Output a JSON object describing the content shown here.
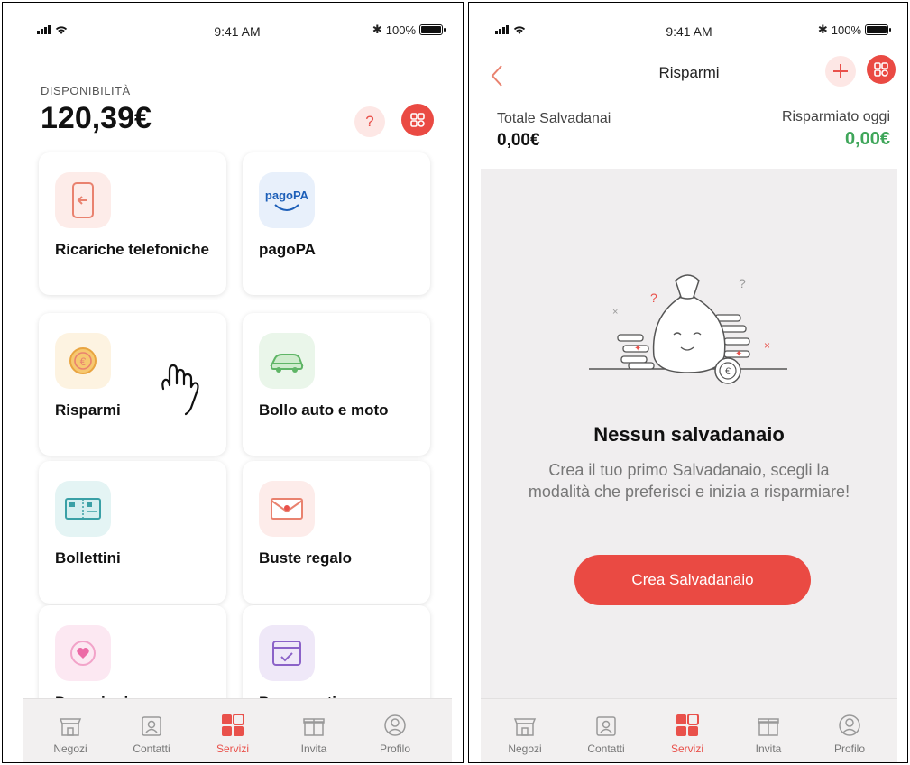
{
  "status_bar": {
    "time": "9:41 AM",
    "battery": "100%",
    "battery_level": 0.9
  },
  "home": {
    "balance_label": "DISPONIBILITÀ",
    "balance_value": "120,39€",
    "help_label": "?",
    "services": [
      {
        "label": "Ricariche telefoniche",
        "icon": "phone-recharge-icon"
      },
      {
        "label": "pagoPA",
        "icon": "pagopa-icon",
        "icon_text": "pagoPA"
      },
      {
        "label": "Risparmi",
        "icon": "euro-coin-icon"
      },
      {
        "label": "Bollo auto e moto",
        "icon": "car-icon"
      },
      {
        "label": "Bollettini",
        "icon": "bill-icon"
      },
      {
        "label": "Buste regalo",
        "icon": "gift-envelope-icon"
      },
      {
        "label": "Donazioni",
        "icon": "heart-icon"
      },
      {
        "label": "Pagamenti",
        "icon": "payment-calendar-icon"
      }
    ]
  },
  "savings": {
    "title": "Risparmi",
    "total_label": "Totale Salvadanai",
    "total_value": "0,00€",
    "today_label": "Risparmiato oggi",
    "today_value": "0,00€",
    "empty_title": "Nessun salvadanaio",
    "empty_desc": "Crea il tuo primo Salvadanaio, scegli la modalità che preferisci e inizia a risparmiare!",
    "create_button": "Crea Salvadanaio"
  },
  "tabbar": {
    "tabs": [
      {
        "label": "Negozi",
        "icon": "shop-icon"
      },
      {
        "label": "Contatti",
        "icon": "contacts-icon"
      },
      {
        "label": "Servizi",
        "icon": "services-icon",
        "active": true
      },
      {
        "label": "Invita",
        "icon": "gift-icon"
      },
      {
        "label": "Profilo",
        "icon": "profile-icon"
      }
    ]
  },
  "colors": {
    "accent": "#ea4a43",
    "green": "#3fa65a",
    "background_gray": "#f0eeef"
  }
}
